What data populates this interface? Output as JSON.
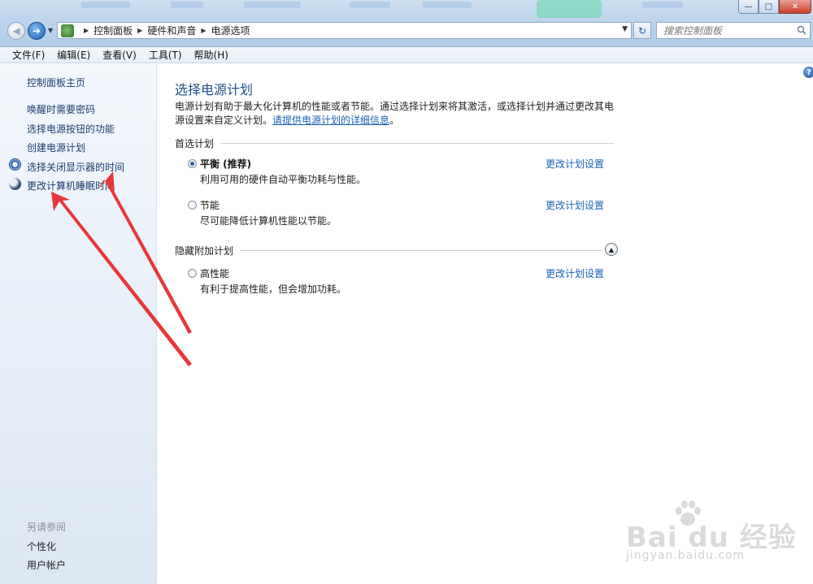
{
  "window": {
    "minimize_icon": "minimize-icon",
    "maximize_icon": "maximize-icon",
    "close_icon": "close-icon",
    "close_glyph": "✕",
    "min_glyph": "—",
    "max_glyph": "□"
  },
  "address_bar": {
    "breadcrumbs": [
      "控制面板",
      "硬件和声音",
      "电源选项"
    ],
    "refresh_glyph": "↻"
  },
  "search": {
    "placeholder": "搜索控制面板"
  },
  "menu": {
    "items": [
      "文件(F)",
      "编辑(E)",
      "查看(V)",
      "工具(T)",
      "帮助(H)"
    ]
  },
  "sidebar": {
    "home": "控制面板主页",
    "links": [
      "唤醒时需要密码",
      "选择电源按钮的功能",
      "创建电源计划",
      "选择关闭显示器的时间",
      "更改计算机睡眠时间"
    ],
    "see_also_title": "另请参阅",
    "see_also_links": [
      "个性化",
      "用户帐户"
    ]
  },
  "main": {
    "title": "选择电源计划",
    "description_text": "电源计划有助于最大化计算机的性能或者节能。通过选择计划来将其激活，或选择计划并通过更改其电源设置来自定义计划。",
    "description_link": "请提供电源计划的详细信息",
    "description_end": "。",
    "preferred_heading": "首选计划",
    "hidden_heading": "隐藏附加计划",
    "plans": [
      {
        "name": "平衡 (推荐)",
        "desc": "利用可用的硬件自动平衡功耗与性能。",
        "link": "更改计划设置",
        "selected": true
      },
      {
        "name": "节能",
        "desc": "尽可能降低计算机性能以节能。",
        "link": "更改计划设置",
        "selected": false
      },
      {
        "name": "高性能",
        "desc": "有利于提高性能，但会增加功耗。",
        "link": "更改计划设置",
        "selected": false
      }
    ],
    "help_glyph": "?"
  },
  "annotation": {
    "arrow_color": "#e8373a"
  },
  "watermark": {
    "brand": "Bai du 经验",
    "url": "jingyan.baidu.com"
  }
}
